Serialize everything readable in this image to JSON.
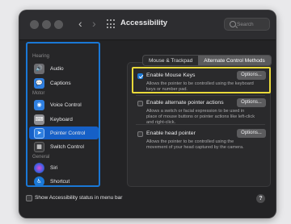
{
  "window": {
    "title": "Accessibility",
    "back_glyph": "‹",
    "forward_glyph": "›",
    "grid_icon": "grid-icon",
    "search_placeholder": "Search"
  },
  "sidebar": {
    "sections": {
      "hearing": "Hearing",
      "motor": "Motor",
      "general": "General"
    },
    "items": [
      {
        "label": "Audio",
        "icon": "speaker-icon",
        "glyph": "🔊",
        "color": "#6c6c70"
      },
      {
        "label": "Captions",
        "icon": "captions-icon",
        "glyph": "💬",
        "color": "#2f7fe0"
      },
      {
        "label": "Voice Control",
        "icon": "voice-control-icon",
        "glyph": "◉",
        "color": "#2f7fe0"
      },
      {
        "label": "Keyboard",
        "icon": "keyboard-icon",
        "glyph": "⌨",
        "color": "#8e8e93"
      },
      {
        "label": "Pointer Control",
        "icon": "pointer-icon",
        "glyph": "➤",
        "color": "#2f7fe0"
      },
      {
        "label": "Switch Control",
        "icon": "switch-icon",
        "glyph": "▦",
        "color": "#3a3a3c"
      },
      {
        "label": "Siri",
        "icon": "siri-icon",
        "glyph": "●",
        "color": "#7a3fd1"
      },
      {
        "label": "Shortcut",
        "icon": "shortcut-icon",
        "glyph": "♿",
        "color": "#1a78d6"
      }
    ],
    "selected": "Pointer Control"
  },
  "tabs": [
    {
      "label": "Mouse & Trackpad",
      "active": false
    },
    {
      "label": "Alternate Control Methods",
      "active": true
    }
  ],
  "options": [
    {
      "title": "Enable Mouse Keys",
      "checked": true,
      "description": "Allows the pointer to be controlled using the keyboard keys or number pad.",
      "button": "Options..."
    },
    {
      "title": "Enable alternate pointer actions",
      "checked": false,
      "description": "Allows a switch or facial expression to be used in place of mouse buttons or pointer actions like left-click and right-click.",
      "button": "Options..."
    },
    {
      "title": "Enable head pointer",
      "checked": false,
      "description": "Allows the pointer to be controlled using the movement of your head captured by the camera.",
      "button": "Options..."
    }
  ],
  "footer": {
    "status_label": "Show Accessibility status in menu bar",
    "help_glyph": "?"
  },
  "colors": {
    "accent": "#1a78d6",
    "highlight": "#e9d93a"
  }
}
